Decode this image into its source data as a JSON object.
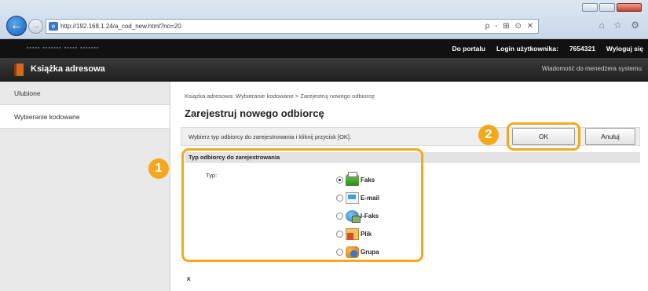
{
  "browser": {
    "url": "http://192.168.1.24/a_cod_new.html?no=20",
    "tools": "ρ - ⊞ ⊙ ✕",
    "tab_icons": "⌂ ☆ ⚙"
  },
  "topbar": {
    "links": [
      "Do portalu",
      "Login użytkownika:",
      "7654321",
      "Wyloguj się"
    ]
  },
  "app": {
    "title": "Książka adresowa",
    "message_link": "Wiadomość do menedżera systemu"
  },
  "sidebar": {
    "items": [
      {
        "label": "Ulubione"
      },
      {
        "label": "Wybieranie kodowane"
      }
    ]
  },
  "main": {
    "breadcrumb": "Książka adresowa: Wybieranie kodowane > Zarejestruj nowego odbiorcę",
    "title": "Zarejestruj nowego odbiorcę",
    "instruction": "Wybierz typ odbiorcy do zarejestrowania i kliknij przycisk [OK].",
    "ok_label": "OK",
    "cancel_label": "Anuluj",
    "section_title": "Typ odbiorcy do zarejestrowania",
    "type_label": "Typ:",
    "options": [
      {
        "label": "Faks",
        "icon": "fax-icon",
        "selected": true
      },
      {
        "label": "E-mail",
        "icon": "email-icon",
        "selected": false
      },
      {
        "label": "I-Faks",
        "icon": "ifax-icon",
        "selected": false
      },
      {
        "label": "Plik",
        "icon": "file-icon",
        "selected": false
      },
      {
        "label": "Grupa",
        "icon": "group-icon",
        "selected": false
      }
    ]
  },
  "callouts": {
    "badge1": "1",
    "badge2": "2",
    "color": "#f4a81d"
  },
  "footer": {
    "top_icon": "⌅"
  }
}
